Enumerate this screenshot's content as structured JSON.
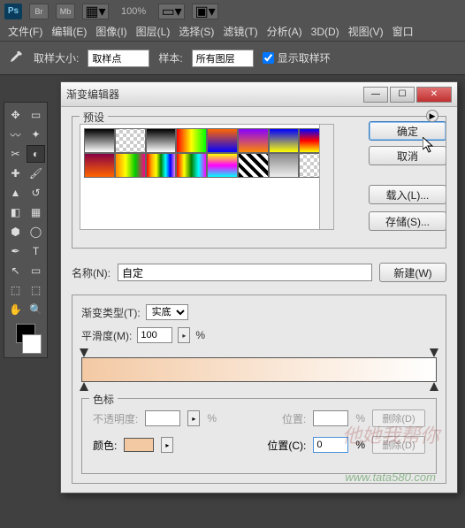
{
  "app": {
    "zoom": "100%"
  },
  "menubar": [
    "文件(F)",
    "编辑(E)",
    "图像(I)",
    "图层(L)",
    "选择(S)",
    "滤镜(T)",
    "分析(A)",
    "3D(D)",
    "视图(V)",
    "窗口"
  ],
  "options": {
    "sample_size_label": "取样大小:",
    "sample_size_value": "取样点",
    "sample_label": "样本:",
    "sample_value": "所有图层",
    "show_ring": "显示取样环"
  },
  "dialog": {
    "title": "渐变编辑器",
    "presets_label": "预设",
    "ok": "确定",
    "cancel": "取消",
    "load": "载入(L)...",
    "save": "存储(S)...",
    "name_label": "名称(N):",
    "name_value": "自定",
    "new_btn": "新建(W)",
    "grad_type_label": "渐变类型(T):",
    "grad_type_value": "实底",
    "smooth_label": "平滑度(M):",
    "smooth_value": "100",
    "percent": "%",
    "stops_label": "色标",
    "opacity_label": "不透明度:",
    "position_label": "位置:",
    "position_c_label": "位置(C):",
    "position_c_value": "0",
    "color_label": "颜色:",
    "delete": "删除(D)"
  },
  "chart_data": {
    "type": "gradient",
    "direction": "horizontal",
    "stops": [
      {
        "position": 0,
        "color": "#f3c9a4"
      },
      {
        "position": 100,
        "color": "#ffffff"
      }
    ],
    "smoothness": 100
  },
  "watermark": {
    "url": "www.tata580.com"
  }
}
